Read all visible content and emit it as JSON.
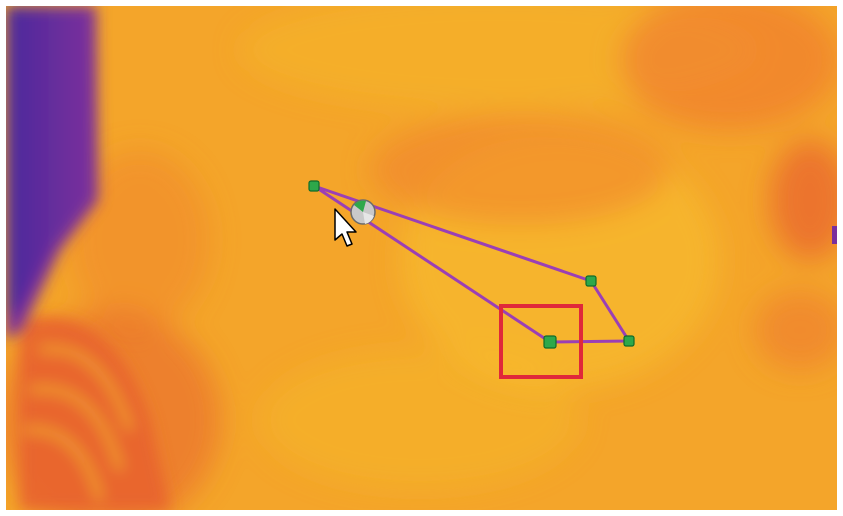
{
  "colors": {
    "frame": "#ffffff",
    "thermal_base": "#f4a52a",
    "thermal_warm": "#f0802e",
    "thermal_hot_edge": "#e8612f",
    "thermal_light": "#f7c12e",
    "thermal_cold": "#4a2a9c",
    "thermal_cold_mid": "#7a2f9c",
    "polygon_line": "#9b3fb5",
    "vertex_fill": "#2ea84a",
    "vertex_stroke": "#106b2a",
    "selection_box": "#e0283a",
    "cursor_fill": "#ffffff",
    "cursor_stroke": "#000000"
  },
  "icons": {
    "cursor": "arrow-cursor-icon",
    "rotate_handle": "rotate-handle-icon"
  }
}
